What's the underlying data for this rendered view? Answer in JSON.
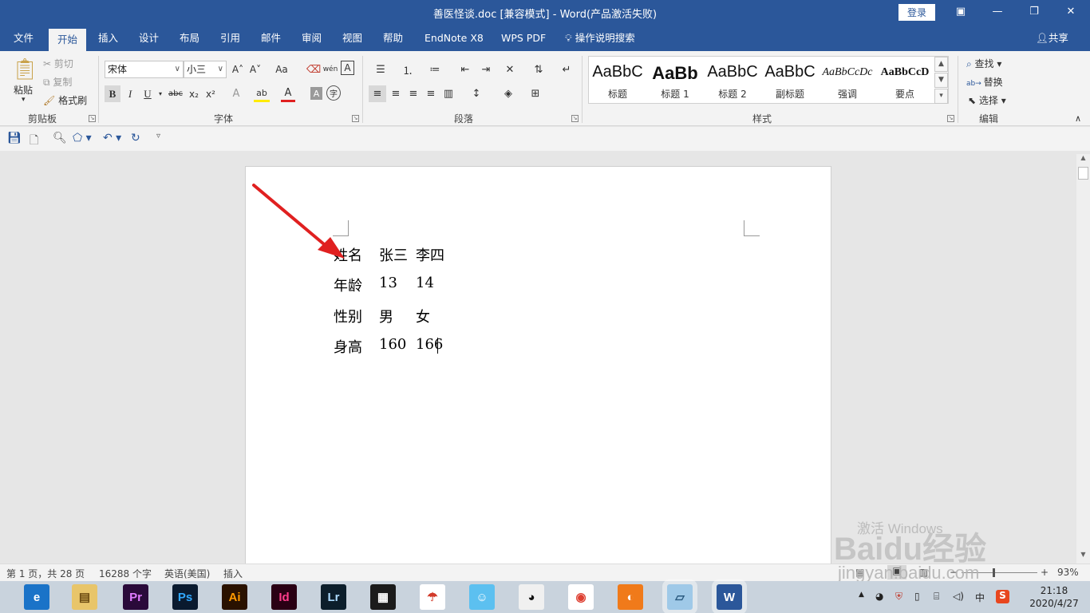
{
  "window": {
    "title": "善医怪谈.doc [兼容模式]  -  Word(产品激活失败)",
    "login": "登录",
    "restore_icon": "▣",
    "minimize_icon": "—",
    "maximize_icon": "❐",
    "close_icon": "✕"
  },
  "tabs": [
    "文件",
    "开始",
    "插入",
    "设计",
    "布局",
    "引用",
    "邮件",
    "审阅",
    "视图",
    "帮助",
    "EndNote X8",
    "WPS PDF"
  ],
  "tell_me": "操作说明搜索",
  "share": "共享",
  "clipboard": {
    "paste": "粘贴",
    "cut": "剪切",
    "copy": "复制",
    "format_painter": "格式刷",
    "label": "剪贴板"
  },
  "font": {
    "family": "宋体",
    "size": "小三",
    "label": "字体",
    "bold": "B",
    "italic": "I",
    "underline": "U",
    "strike": "abc",
    "sub": "x₂",
    "sup": "x²",
    "grow": "A˄",
    "shrink": "A˅",
    "case": "Aa",
    "pinyin": "wén",
    "border_a": "A",
    "effects": "A",
    "highlight": "ab",
    "color": "A",
    "shade": "A",
    "enclose": "字"
  },
  "paragraph": {
    "label": "段落"
  },
  "styles": {
    "label": "样式",
    "items": [
      {
        "sample": "AaBbC",
        "name": "标题"
      },
      {
        "sample": "AaBb",
        "name": "标题 1"
      },
      {
        "sample": "AaBbC",
        "name": "标题 2"
      },
      {
        "sample": "AaBbC",
        "name": "副标题"
      },
      {
        "sample": "AaBbCcDc",
        "name": "强调"
      },
      {
        "sample": "AaBbCcD",
        "name": "要点"
      }
    ]
  },
  "editing": {
    "find": "查找",
    "replace": "替换",
    "select": "选择",
    "label": "编辑"
  },
  "document": {
    "rows": [
      [
        "姓名",
        "张三",
        "李四"
      ],
      [
        "年龄",
        "13",
        "14"
      ],
      [
        "性别",
        "男",
        "女"
      ],
      [
        "身高",
        "160",
        "166"
      ]
    ]
  },
  "watermark": {
    "activate": "激活 Windows",
    "baidu": "Baidu经验",
    "url": "jingyan.baidu.com"
  },
  "status": {
    "page": "第 1 页，共 28 页",
    "words": "16288 个字",
    "language": "英语(美国)",
    "mode": "插入",
    "zoom": "93%",
    "zoom_minus": "−",
    "zoom_plus": "+"
  },
  "taskbar": {
    "apps": [
      {
        "name": "browser",
        "label": "e",
        "bg": "#1a73c8",
        "fg": "#ffffff"
      },
      {
        "name": "file-explorer",
        "label": "▤",
        "bg": "#e8c56a",
        "fg": "#6b4a10"
      },
      {
        "name": "premiere",
        "label": "Pr",
        "bg": "#2a0a3a",
        "fg": "#e07cff"
      },
      {
        "name": "photoshop",
        "label": "Ps",
        "bg": "#0a1a2f",
        "fg": "#31a8ff"
      },
      {
        "name": "illustrator",
        "label": "Ai",
        "bg": "#2a1200",
        "fg": "#ff9a00"
      },
      {
        "name": "indesign",
        "label": "Id",
        "bg": "#2a0014",
        "fg": "#ff3d8b"
      },
      {
        "name": "lightroom",
        "label": "Lr",
        "bg": "#0c1e2b",
        "fg": "#addcff"
      },
      {
        "name": "video-editor",
        "label": "▦",
        "bg": "#1b1b1b",
        "fg": "#ffffff"
      },
      {
        "name": "umbrella-app",
        "label": "☂",
        "bg": "#ffffff",
        "fg": "#d23a2a"
      },
      {
        "name": "chat-app",
        "label": "☺",
        "bg": "#5cc0f0",
        "fg": "#ffffff"
      },
      {
        "name": "qq",
        "label": "◕",
        "bg": "#f0f0f0",
        "fg": "#111111"
      },
      {
        "name": "chrome",
        "label": "◉",
        "bg": "#ffffff",
        "fg": "#de4032"
      },
      {
        "name": "fox-app",
        "label": "◐",
        "bg": "#f07a1a",
        "fg": "#ffffff"
      },
      {
        "name": "notes-app",
        "label": "▱",
        "bg": "#9fc9e8",
        "fg": "#2a5a80"
      },
      {
        "name": "word",
        "label": "W",
        "bg": "#2b579a",
        "fg": "#ffffff"
      }
    ],
    "tray_ime": "中",
    "tray_sogou": "S",
    "clock_time": "21:18",
    "clock_date": "2020/4/27"
  },
  "colors": {
    "accent": "#2b579a",
    "arrow": "#e02020"
  }
}
